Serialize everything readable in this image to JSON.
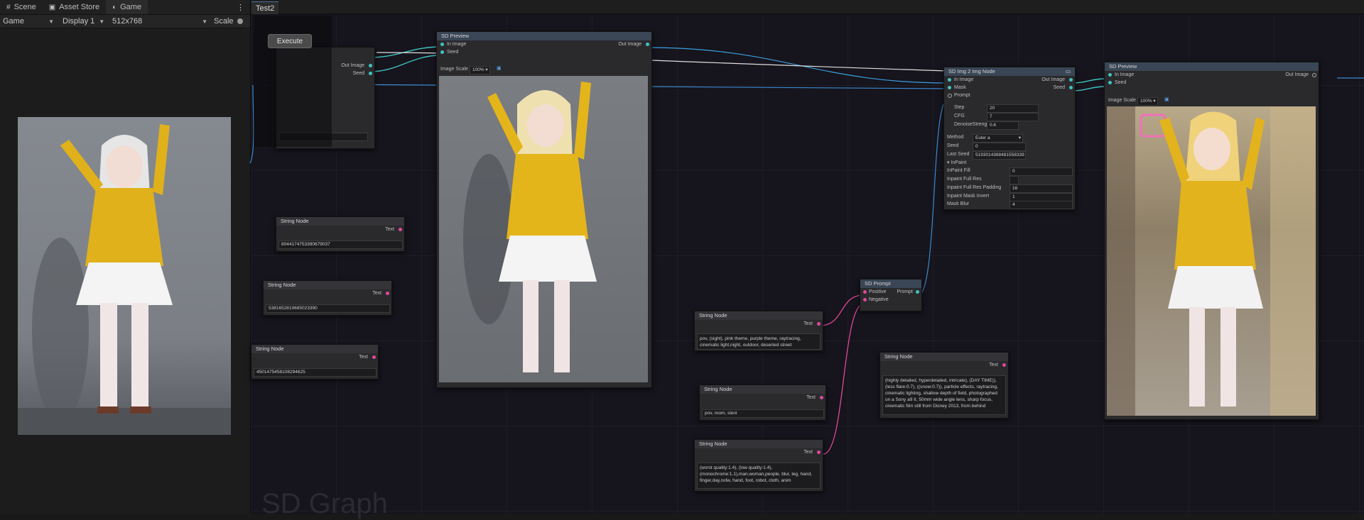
{
  "editor_tabs": [
    {
      "label": "Scene",
      "icon": "scene-icon"
    },
    {
      "label": "Asset Store",
      "icon": "store-icon"
    },
    {
      "label": "Game",
      "icon": "gamepad-icon"
    }
  ],
  "game_toolbar": {
    "mode": "Game",
    "display": "Display 1",
    "resolution": "512x768",
    "scale_label": "Scale"
  },
  "graph_tab": "Test2",
  "execute_label": "Execute",
  "graph_title": "SD Graph",
  "colors": {
    "teal": "#3fc4c0",
    "pink": "#e0489a",
    "node_bg": "#2a2a2d"
  },
  "nodes": {
    "preview1": {
      "title": "SD Preview",
      "in_image": "In Image",
      "seed": "Seed",
      "out_image": "Out Image",
      "image_scale_label": "Image Scale",
      "image_scale": "100%"
    },
    "partial_node": {
      "out_image": "Out Image",
      "seed": "Seed"
    },
    "img2img": {
      "title": "SD Img 2 Img Node",
      "in_image": "In Image",
      "mask": "Mask",
      "prompt": "Prompt",
      "out_image": "Out Image",
      "seed_out": "Seed",
      "step_label": "Step",
      "step": "20",
      "cfg_label": "CFG",
      "cfg": "7",
      "denoise_label": "DenoiseStrength",
      "denoise": "0.6",
      "method_label": "Method",
      "method": "Euler a",
      "seed_label": "Seed",
      "seed": "0",
      "last_seed_label": "Last Seed",
      "last_seed": "5193014388481558339",
      "inpaint_header": "InPaint",
      "inpaint_fill_label": "InPaint Fill",
      "inpaint_fill": "0",
      "full_res_label": "Inpaint Full Res",
      "full_res_padding_label": "Inpaint Full Res Padding",
      "full_res_padding": "16",
      "mask_invert_label": "Inpaint Mask Invert",
      "mask_invert": "1",
      "mask_blur_label": "Mask Blur",
      "mask_blur": "4"
    },
    "preview2": {
      "title": "SD Preview",
      "in_image": "In Image",
      "seed": "Seed",
      "out_image": "Out Image",
      "image_scale_label": "Image Scale",
      "image_scale": "100%"
    },
    "prompt": {
      "title": "SD Prompt",
      "positive": "Positive",
      "negative": "Negative",
      "prompt_out": "Prompt"
    },
    "string1": {
      "title": "String Node",
      "out": "Text",
      "value": "8044174753390679037"
    },
    "string2": {
      "title": "String Node",
      "out": "Text",
      "value": "5381652819685023390"
    },
    "string3": {
      "title": "String Node",
      "out": "Text",
      "value": "4501475458108294625"
    },
    "string4": {
      "title": "String Node",
      "out": "Text",
      "value": "pov, (sight), pink theme, purple theme, raytracing, cinematic light,night, outdoor, deserted street"
    },
    "string5": {
      "title": "String Node",
      "out": "Text",
      "value": "pov, room, sleni"
    },
    "string6": {
      "title": "String Node",
      "out": "Text",
      "value": "(worst quality:1.4), (low quality:1.4), (monochrome:1.1),man,woman,people, blur, leg, hand, finger,day,nsfw, hand, foot, robot, cloth, anim"
    },
    "string7": {
      "title": "String Node",
      "out": "Text",
      "value": "(highly detailed, hyperdetailed, intricate), (DAY TIME)), (less flare:0.7), ((snow:0.7)), particle effects, raytracing, cinematic lighting, shallow depth of field, photographed on a Sony a9 II, 50mm wide angle lens, sharp focus, cinematic film still from Disney 2013, from behind"
    }
  }
}
